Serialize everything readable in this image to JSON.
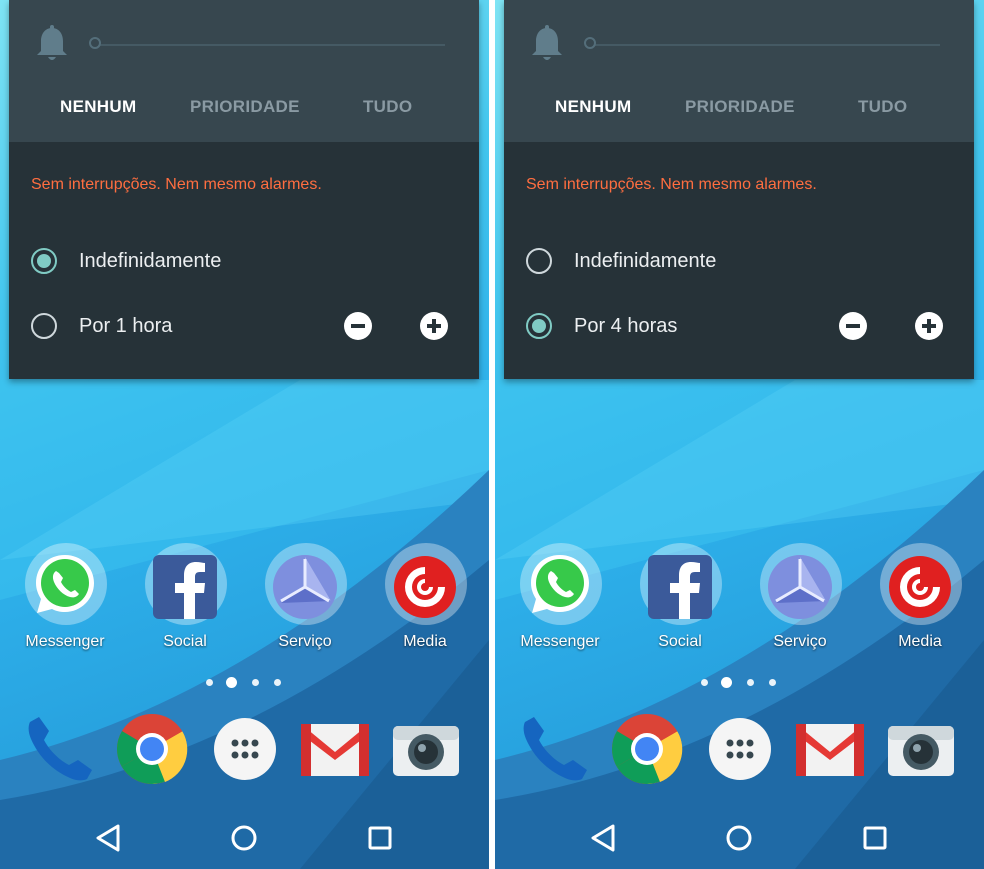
{
  "screens": [
    {
      "tabs": [
        "NENHUM",
        "PRIORIDADE",
        "TUDO"
      ],
      "active_tab": "NENHUM",
      "warning": "Sem interrupções. Nem mesmo alarmes.",
      "options": [
        {
          "label": "Indefinidamente",
          "selected": true
        },
        {
          "label": "Por 1 hora",
          "selected": false
        }
      ]
    },
    {
      "tabs": [
        "NENHUM",
        "PRIORIDADE",
        "TUDO"
      ],
      "active_tab": "NENHUM",
      "warning": "Sem interrupções. Nem mesmo alarmes.",
      "options": [
        {
          "label": "Indefinidamente",
          "selected": false
        },
        {
          "label": "Por 4 horas",
          "selected": true
        }
      ]
    }
  ],
  "home": {
    "apps": [
      "Messenger",
      "Social",
      "Serviço",
      "Media"
    ],
    "dock": [
      "phone-icon",
      "chrome-icon",
      "app-drawer-icon",
      "gmail-icon",
      "camera-icon"
    ],
    "page_indicator": {
      "count": 4,
      "current": 2
    }
  },
  "nav": [
    "back-icon",
    "home-icon",
    "recents-icon"
  ],
  "colors": {
    "panel": "#263238",
    "panel_header": "#37474f",
    "warning": "#ff6e40",
    "radio_accent": "#80cbc4"
  }
}
